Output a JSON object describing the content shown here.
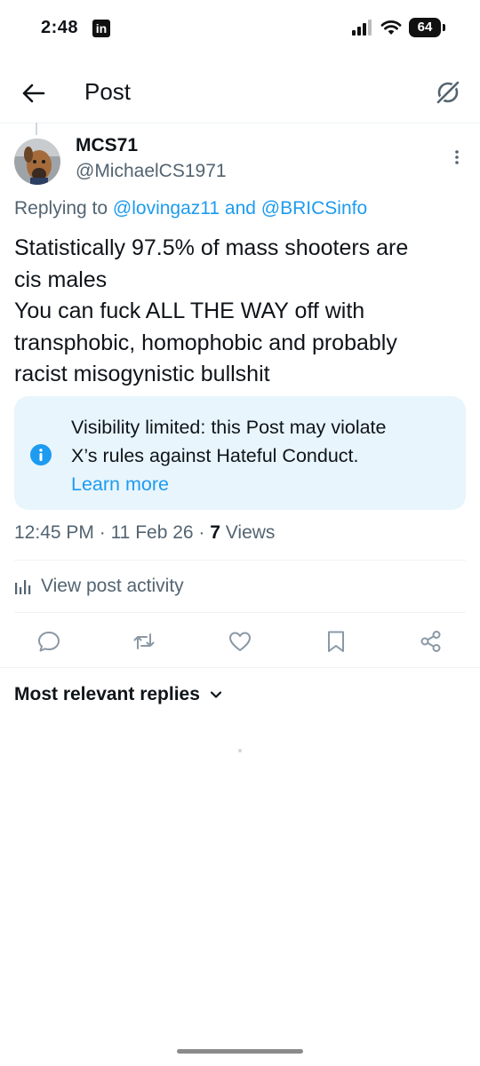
{
  "status_bar": {
    "time": "2:48",
    "app_badge": "in",
    "battery": "64"
  },
  "header": {
    "title": "Post",
    "back_icon": "arrow-left-icon",
    "grok_icon": "grok-icon"
  },
  "post": {
    "author": {
      "display_name": "MCS71",
      "handle": "@MichaelCS1971"
    },
    "replying": {
      "prefix": "Replying to ",
      "user1": "@lovingaz11",
      "and": " and ",
      "user2": "@BRICSinfo"
    },
    "text_lines": [
      "Statistically 97.5% of mass shooters are",
      "cis males",
      "You can fuck ALL THE WAY off with",
      "transphobic, homophobic and probably",
      "racist misogynistic bullshit"
    ],
    "notice": {
      "line1": "Visibility limited: this Post may violate",
      "line2": "X’s rules against Hateful Conduct.",
      "learn_more": "Learn more"
    },
    "meta": {
      "time": "12:45 PM",
      "sep1": " · ",
      "date": "11 Feb 26",
      "sep2": " · ",
      "views_count": "7",
      "views_label": " Views"
    },
    "activity_label": "View post activity"
  },
  "replies": {
    "sort_label": "Most relevant replies"
  },
  "colors": {
    "accent": "#1d9bf0",
    "secondary_text": "#536471",
    "notice_bg": "#e8f5fd"
  }
}
